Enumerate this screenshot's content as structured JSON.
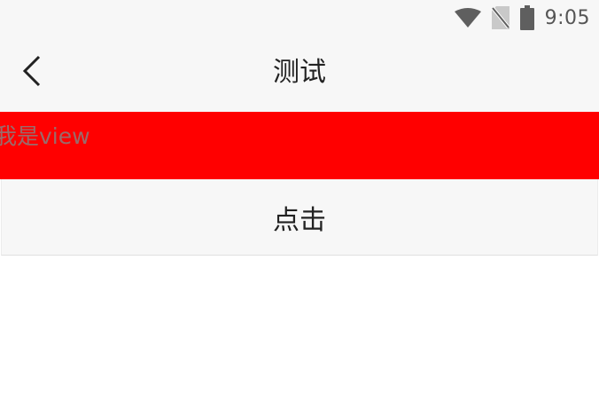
{
  "status_bar": {
    "time": "9:05",
    "icons": [
      "wifi-icon",
      "no-sim-icon",
      "battery-icon"
    ]
  },
  "app_bar": {
    "title": "测试",
    "back_icon": "chevron-left-icon"
  },
  "red_view": {
    "text": "我是view",
    "background": "#ff0000"
  },
  "action": {
    "button_label": "点击"
  }
}
